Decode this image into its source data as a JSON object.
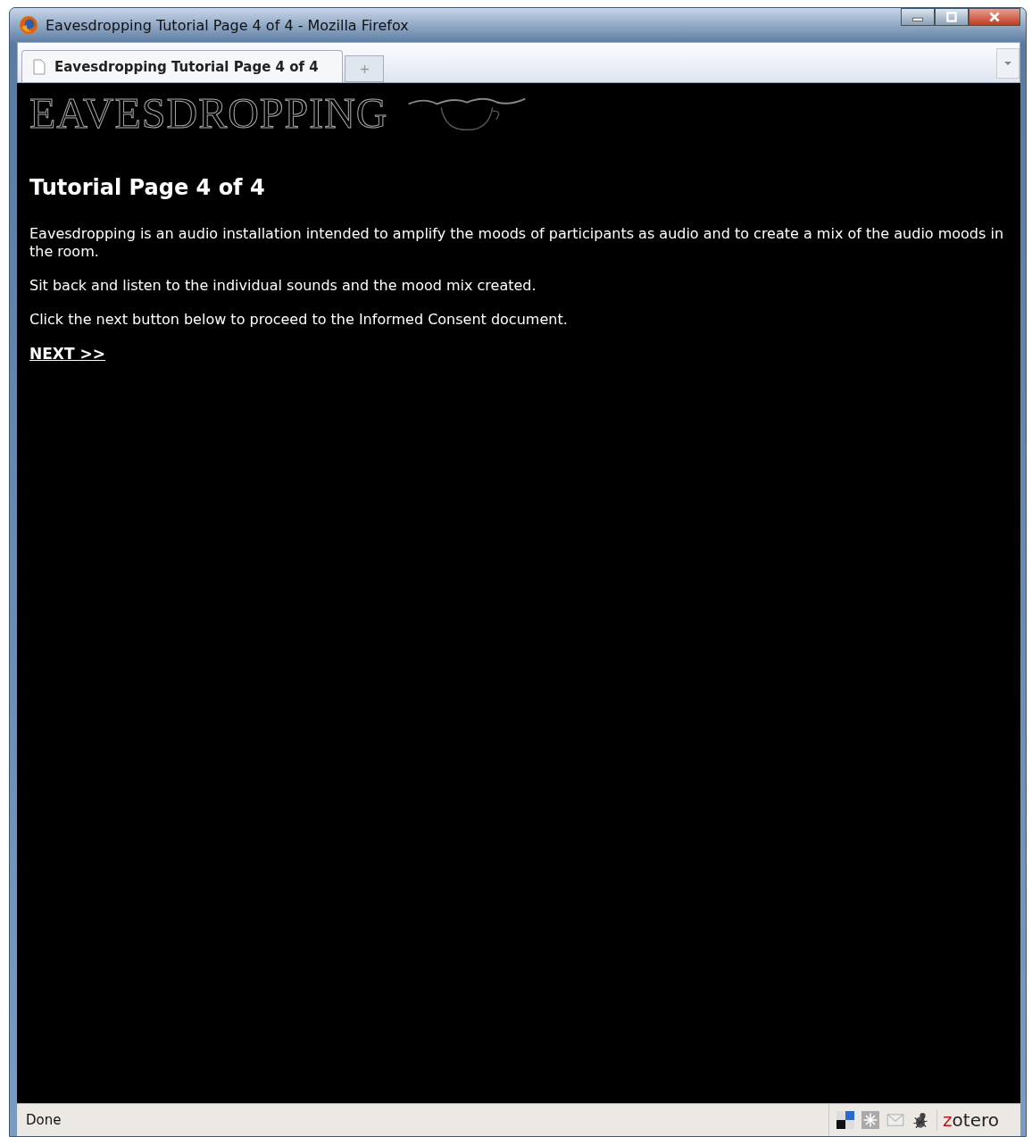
{
  "window": {
    "title": "Eavesdropping Tutorial Page 4 of 4 - Mozilla Firefox"
  },
  "tabs": [
    {
      "label": "Eavesdropping Tutorial Page 4 of 4",
      "selected": true
    }
  ],
  "page": {
    "logo": "EAVESDROPPING",
    "heading": "Tutorial Page 4 of 4",
    "paragraphs": [
      "Eavesdropping is an audio installation intended to amplify the moods of participants as audio and to create a mix of the audio moods in the room.",
      "Sit back and listen to the individual sounds and the mood mix created.",
      "Click the next button below to proceed to the Informed Consent document."
    ],
    "link": "NEXT >>"
  },
  "status_bar": {
    "text": "Done",
    "addon": "zotero"
  }
}
